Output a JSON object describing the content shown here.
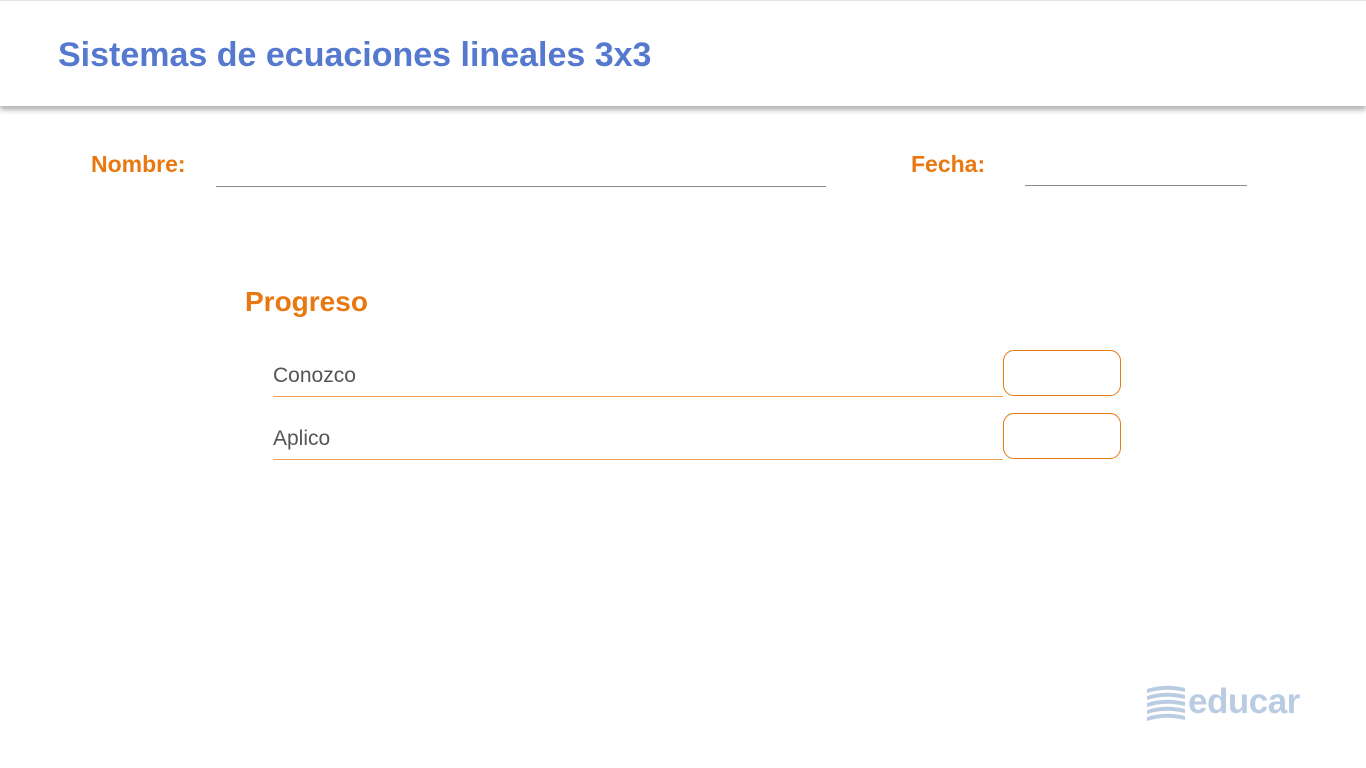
{
  "header": {
    "title": "Sistemas de ecuaciones lineales 3x3"
  },
  "form": {
    "name_label": "Nombre:",
    "date_label": "Fecha:"
  },
  "progress": {
    "title": "Progreso",
    "items": [
      {
        "label": "Conozco"
      },
      {
        "label": "Aplico"
      }
    ]
  },
  "logo": {
    "text": "educar",
    "icon": "stacked-books-icon"
  },
  "colors": {
    "title": "#5479cf",
    "accent": "#e8780f",
    "logo": "#b9cce2"
  }
}
